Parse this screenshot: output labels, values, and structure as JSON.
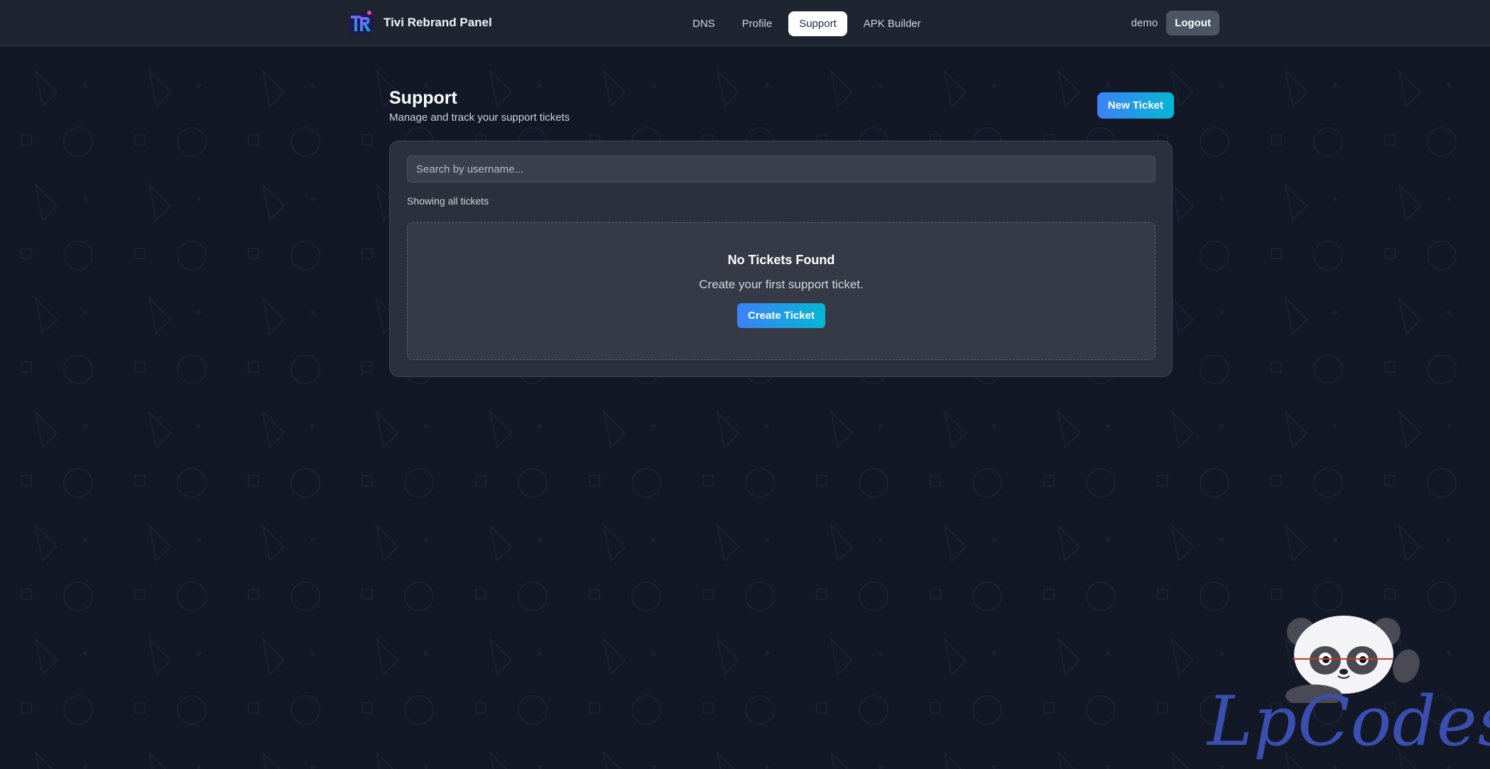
{
  "brand": {
    "title": "Tivi Rebrand Panel",
    "logo_icon": "tr-logo-icon"
  },
  "nav": {
    "links": [
      {
        "label": "DNS",
        "active": false
      },
      {
        "label": "Profile",
        "active": false
      },
      {
        "label": "Support",
        "active": true
      },
      {
        "label": "APK Builder",
        "active": false
      }
    ]
  },
  "user": {
    "name": "demo",
    "logout_label": "Logout"
  },
  "page": {
    "title": "Support",
    "subtitle": "Manage and track your support tickets",
    "new_ticket_label": "New Ticket"
  },
  "search": {
    "placeholder": "Search by username...",
    "value": ""
  },
  "filter_status": "Showing all tickets",
  "empty_state": {
    "title": "No Tickets Found",
    "message": "Create your first support ticket.",
    "button_label": "Create Ticket"
  },
  "watermark": {
    "text": "LpCodes",
    "icon": "panda-icon"
  },
  "colors": {
    "background": "#121826",
    "navbar": "#1f2431",
    "card": "#2b303c",
    "accent_start": "#3b82f6",
    "accent_end": "#06b6d4",
    "watermark": "#3b4fb0"
  }
}
